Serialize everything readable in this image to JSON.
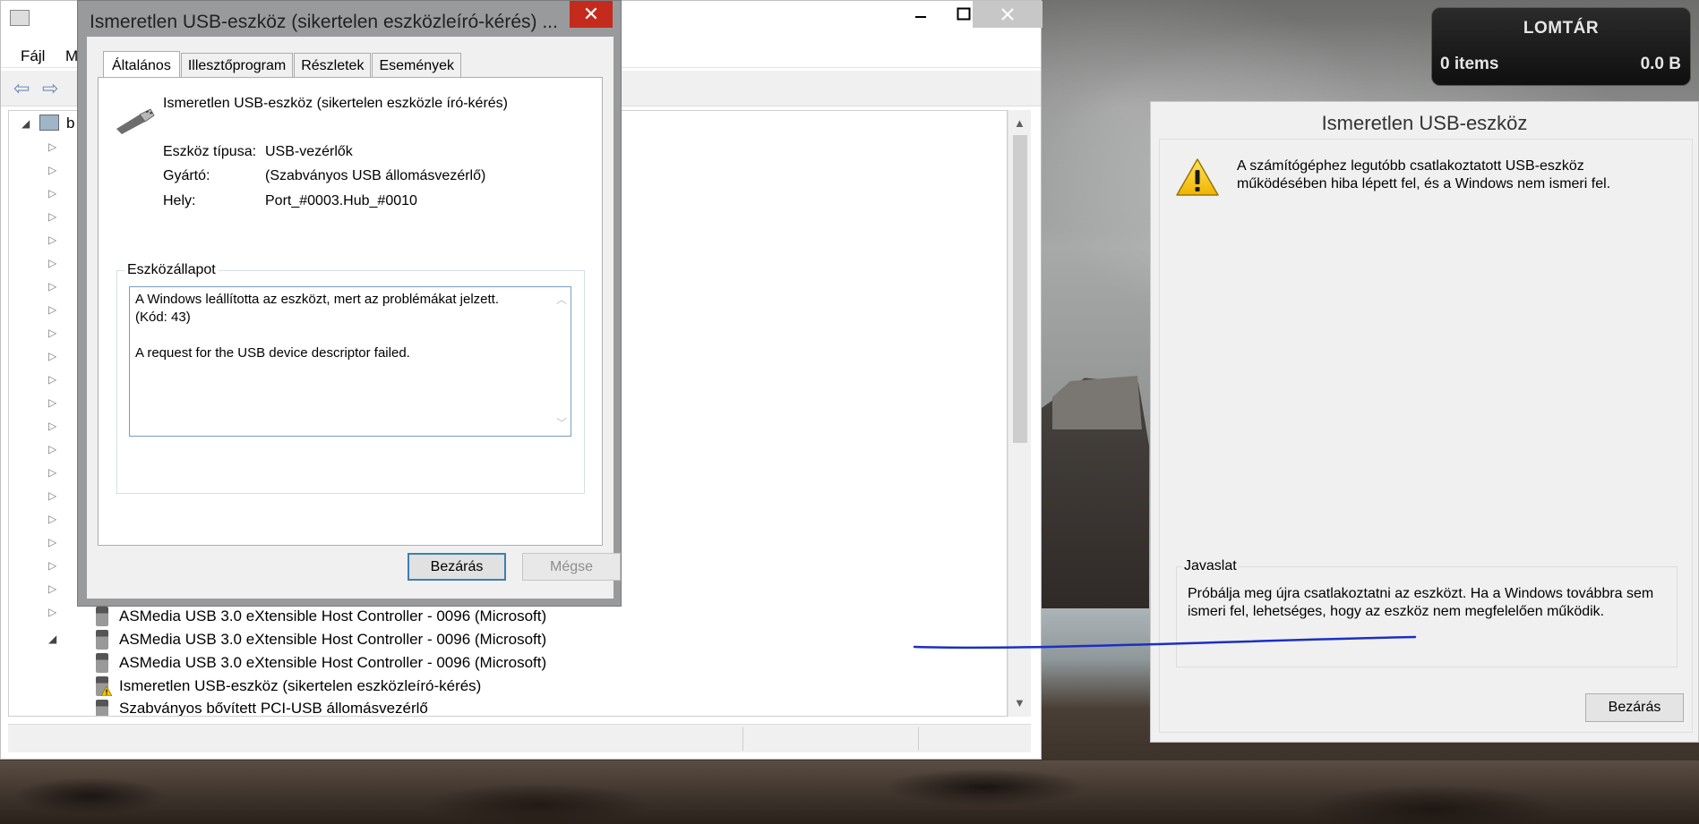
{
  "device_manager": {
    "menu": {
      "file": "Fájl",
      "action_partial": "M"
    },
    "tree_root_label_partial": "b",
    "tree_children": [
      "ASMedia USB 3.0 eXtensible Host Controller - 0096 (Microsoft)",
      "ASMedia USB 3.0 eXtensible Host Controller - 0096 (Microsoft)",
      "ASMedia USB 3.0 eXtensible Host Controller - 0096 (Microsoft)",
      "Ismeretlen USB-eszköz (sikertelen eszközleíró-kérés)",
      "Szabványos bővített PCI-USB állomásvezérlő"
    ]
  },
  "properties_dialog": {
    "title": "Ismeretlen USB-eszköz (sikertelen eszközleíró-kérés) ...",
    "close_icon": "✕",
    "tabs": [
      "Általános",
      "Illesztőprogram",
      "Részletek",
      "Események"
    ],
    "device_name": "Ismeretlen USB-eszköz (sikertelen eszközle író-kérés)",
    "fields": {
      "type_label": "Eszköz típusa:",
      "type_value": "USB-vezérlők",
      "mfr_label": "Gyártó:",
      "mfr_value": "(Szabványos USB állomásvezérlő)",
      "loc_label": "Hely:",
      "loc_value": "Port_#0003.Hub_#0010"
    },
    "status_group_title": "Eszközállapot",
    "status_line1": "A Windows leállította az eszközt, mert az problémákat jelzett.",
    "status_line2": "(Kód: 43)",
    "status_line3": "A request for the USB device descriptor failed.",
    "btn_close": "Bezárás",
    "btn_cancel": "Mégse"
  },
  "recycle_bin": {
    "title": "LOMTÁR",
    "items": "0 items",
    "size": "0.0 B"
  },
  "notification": {
    "title": "Ismeretlen USB-eszköz",
    "message": "A számítógéphez legutóbb csatlakoztatott USB-eszköz működésében hiba lépett fel, és a Windows nem ismeri fel.",
    "suggestion_title": "Javaslat",
    "suggestion_text": "Próbálja meg újra csatlakoztatni az eszközt. Ha a Windows továbbra sem ismeri fel, lehetséges, hogy az eszköz nem megfelelően működik.",
    "btn_close": "Bezárás"
  },
  "colors": {
    "close_red": "#c42b1c",
    "focus_blue": "#3c7fb1",
    "annotation_line": "#1c2fc4"
  }
}
